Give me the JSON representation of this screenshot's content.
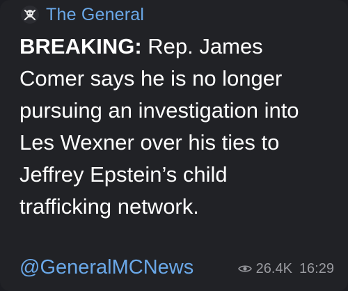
{
  "channel": {
    "name": "The General"
  },
  "message": {
    "lines": [
      {
        "lead": "BREAKING:",
        "text": " Rep. James"
      },
      {
        "text": "Comer says he is no longer"
      },
      {
        "text": "pursuing an investigation into"
      },
      {
        "text": "Les Wexner over his ties to"
      },
      {
        "text": "Jeffrey Epstein’s child"
      },
      {
        "text": "trafficking network."
      }
    ]
  },
  "footer": {
    "handle": "@GeneralMCNews",
    "views": "26.4K",
    "time": "16:29"
  },
  "icons": {
    "avatar": "skull-crossbones-avatar-icon",
    "views": "eye-icon"
  },
  "colors": {
    "background": "#212226",
    "link": "#6aa8e8",
    "text": "#ffffff",
    "meta": "#9a9ba0"
  }
}
